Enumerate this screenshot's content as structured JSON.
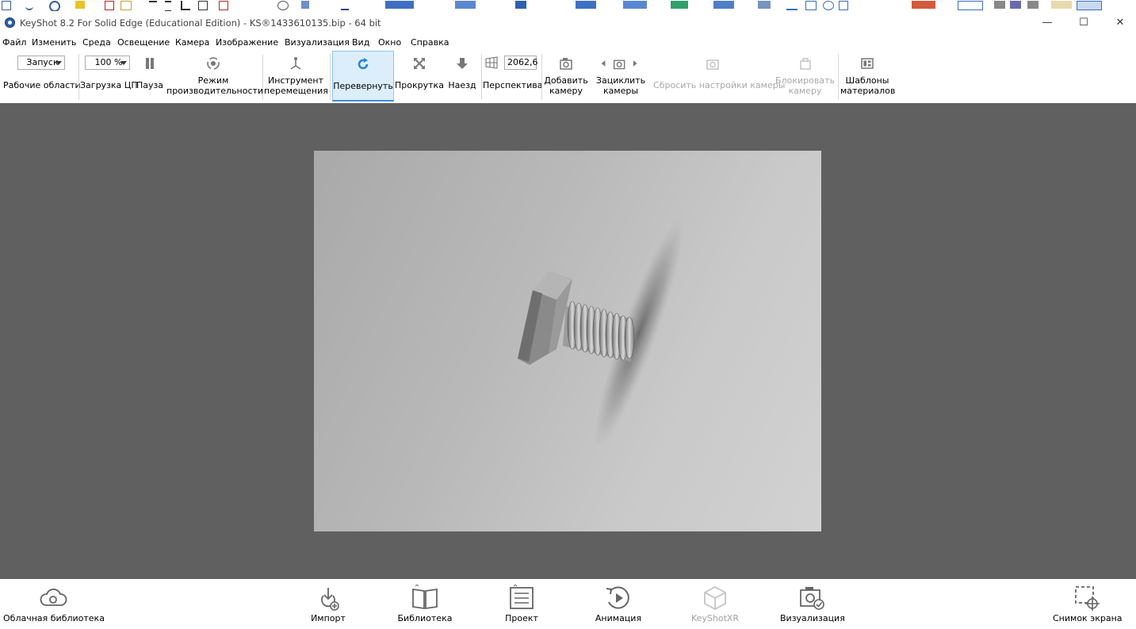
{
  "window": {
    "title": "KeyShot 8.2 For Solid Edge (Educational Edition) - KS®1433610135.bip  - 64 bit",
    "minimize": "—",
    "maximize": "☐",
    "close": "✕"
  },
  "menu": [
    "Файл",
    "Изменить",
    "Среда",
    "Освещение",
    "Камера",
    "Изображение",
    "Визуализация",
    "Вид",
    "Окно",
    "Справка"
  ],
  "toolbar": {
    "workspace_value": "Запуск",
    "workspace_label": "Рабочие области",
    "cpu_value": "100 %",
    "cpu_label": "Загрузка ЦП",
    "pause_label": "Пауза",
    "perf_label": "Режим производительности",
    "move_label": "Инструмент перемещения",
    "tumble_label": "Перевернуть",
    "pan_label": "Прокрутка",
    "dolly_label": "Наезд",
    "perspective_label": "Перспектива",
    "perspective_value": "2062,6",
    "add_camera_label": "Добавить камеру",
    "cycle_camera_label": "Зациклить камеры",
    "reset_camera_label": "Сбросить настройки камеры",
    "lock_camera_label": "Блокировать камеру",
    "material_templates_label": "Шаблоны материалов"
  },
  "bottom": {
    "cloud": "Облачная библиотека",
    "import": "Импорт",
    "library": "Библиотека",
    "project": "Проект",
    "animation": "Анимация",
    "keyshotxr": "KeyShotXR",
    "render": "Визуализация",
    "screenshot": "Снимок экрана"
  },
  "colors": {
    "accent": "#3b8fd6",
    "viewport_bg": "#606060",
    "active_tab_bg": "#dceefb"
  },
  "icons": [
    "keyshot-app-icon",
    "pause-icon",
    "performance-icon",
    "move-tool-icon",
    "tumble-icon",
    "pan-icon",
    "dolly-icon",
    "perspective-icon",
    "add-camera-icon",
    "cycle-camera-icon",
    "reset-camera-icon",
    "lock-camera-icon",
    "material-templates-icon",
    "cloud-library-icon",
    "import-icon",
    "library-icon",
    "project-icon",
    "animation-icon",
    "keyshotxr-icon",
    "render-icon",
    "screenshot-icon"
  ]
}
